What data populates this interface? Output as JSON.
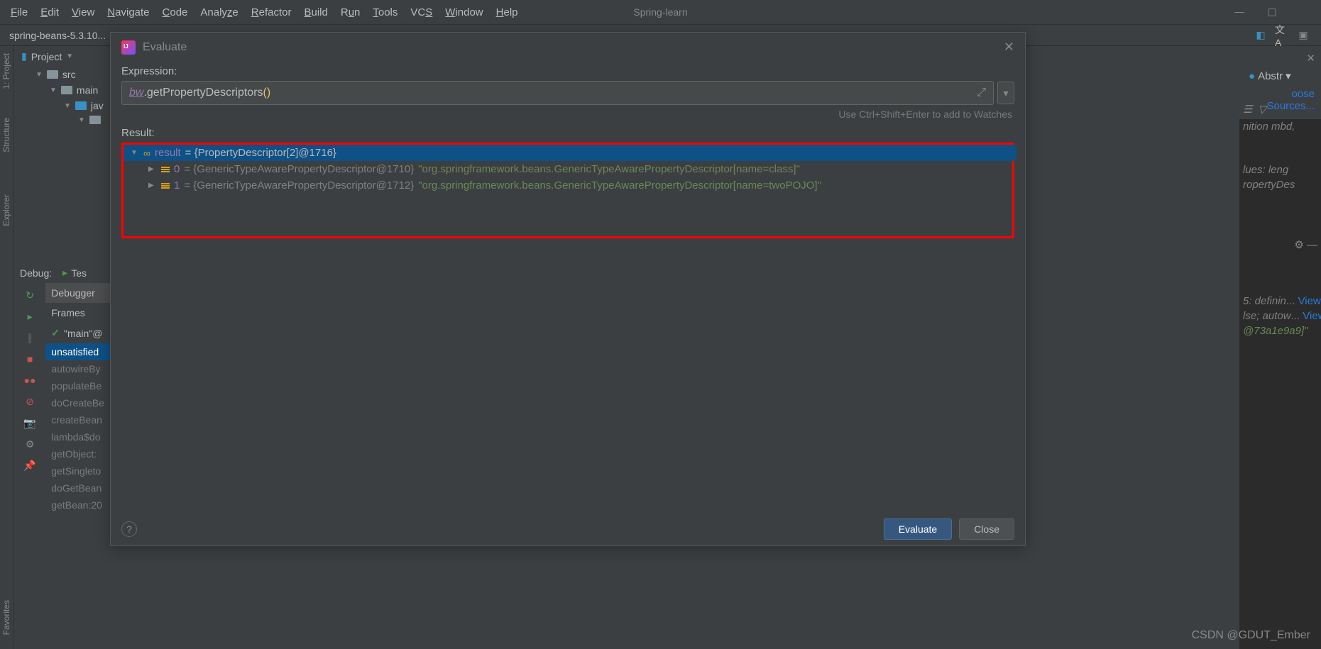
{
  "menu": {
    "items": [
      "File",
      "Edit",
      "View",
      "Navigate",
      "Code",
      "Analyze",
      "Refactor",
      "Build",
      "Run",
      "Tools",
      "VCS",
      "Window",
      "Help"
    ],
    "project": "Spring-learn"
  },
  "breadcrumb": "spring-beans-5.3.10...",
  "project_tree": {
    "header": "Project",
    "items": [
      {
        "label": "src",
        "indent": 1
      },
      {
        "label": "main",
        "indent": 2
      },
      {
        "label": "jav",
        "indent": 3
      },
      {
        "label": "",
        "indent": 4
      }
    ]
  },
  "debug": {
    "header": "Debug:",
    "tab": "Tes",
    "debugger": "Debugger",
    "frames": "Frames",
    "main_thread": "\"main\"@",
    "stack": [
      "unsatisfied",
      "autowireBy",
      "populateBe",
      "doCreateBe",
      "createBean",
      "lambda$do",
      "getObject:",
      "getSingleto",
      "doGetBean",
      "getBean:20"
    ]
  },
  "dialog": {
    "title": "Evaluate",
    "expression_label": "Expression:",
    "expression_bw": "bw",
    "expression_method": ".getPropertyDescriptors",
    "expression_paren": "()",
    "hint": "Use Ctrl+Shift+Enter to add to Watches",
    "result_label": "Result:",
    "result": {
      "root_key": "result",
      "root_val": " = {PropertyDescriptor[2]@1716}",
      "item0_key": "0",
      "item0_type": " = {GenericTypeAwarePropertyDescriptor@1710} ",
      "item0_val": "\"org.springframework.beans.GenericTypeAwarePropertyDescriptor[name=class]\"",
      "item1_key": "1",
      "item1_type": " = {GenericTypeAwarePropertyDescriptor@1712} ",
      "item1_val": "\"org.springframework.beans.GenericTypeAwarePropertyDescriptor[name=twoPOJO]\""
    },
    "evaluate_btn": "Evaluate",
    "close_btn": "Close"
  },
  "right_panel": {
    "abstr": "Abstr",
    "sources": "oose Sources...",
    "code1": "nition mbd,",
    "code2": "lues: leng",
    "code3": "ropertyDes",
    "val1_a": "5: definin",
    "val1_b": "View",
    "val2_a": "lse; autow",
    "val2_b": "View",
    "val3": "@73a1e9a9]\""
  },
  "watermark": "CSDN @GDUT_Ember"
}
